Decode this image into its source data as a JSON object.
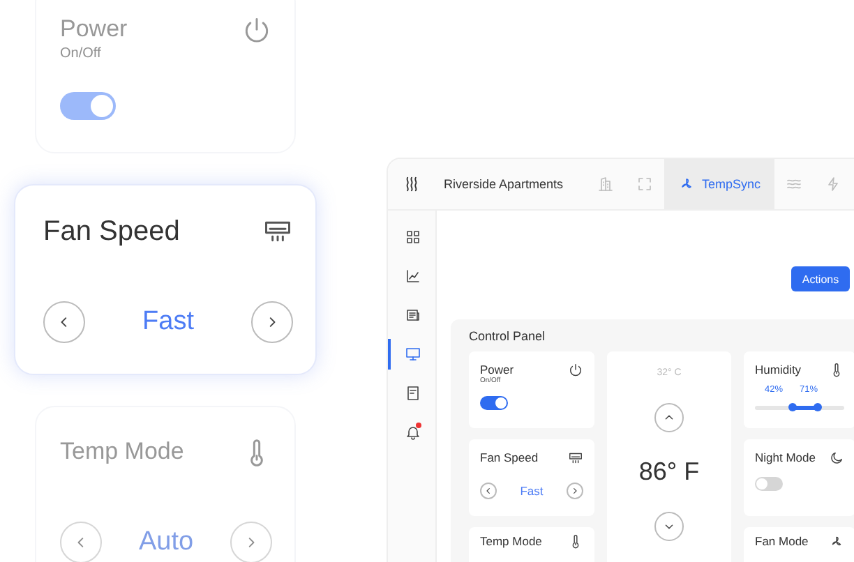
{
  "showcase_cards": [
    {
      "kind": "toggle",
      "title": "Power",
      "subtitle": "On/Off",
      "on": true,
      "highlighted": false
    },
    {
      "kind": "selector",
      "title": "Fan Speed",
      "value": "Fast",
      "highlighted": true
    },
    {
      "kind": "selector",
      "title": "Temp Mode",
      "value": "Auto",
      "highlighted": false
    }
  ],
  "app": {
    "header": {
      "property": "Riverside Apartments",
      "tabs": [
        {
          "selected": false
        },
        {
          "selected": false
        },
        {
          "label": "TempSync",
          "selected": true
        },
        {
          "selected": false
        },
        {
          "selected": false
        }
      ]
    },
    "sidebar": [
      {
        "selected": false,
        "alert": false
      },
      {
        "selected": false,
        "alert": false
      },
      {
        "selected": false,
        "alert": false
      },
      {
        "selected": true,
        "alert": false
      },
      {
        "selected": false,
        "alert": false
      },
      {
        "selected": false,
        "alert": true
      }
    ],
    "actions_button": "Actions",
    "control_panel": {
      "title": "Control Panel",
      "columns": [
        [
          {
            "kind": "toggle",
            "title": "Power",
            "subtitle": "On/Off",
            "on": true
          },
          {
            "kind": "selector",
            "title": "Fan Speed",
            "value": "Fast"
          },
          {
            "kind": "title",
            "title": "Temp Mode"
          }
        ],
        [
          {
            "kind": "temperature",
            "secondary": "32° C",
            "primary": "86° F"
          }
        ],
        [
          {
            "kind": "range",
            "title": "Humidity",
            "range": [
              {
                "label": "42%",
                "level": 0.42
              },
              {
                "label": "71%",
                "level": 0.71
              }
            ]
          },
          {
            "kind": "toggle",
            "title": "Night Mode",
            "on": false
          },
          {
            "kind": "title",
            "title": "Fan Mode"
          }
        ]
      ]
    }
  }
}
